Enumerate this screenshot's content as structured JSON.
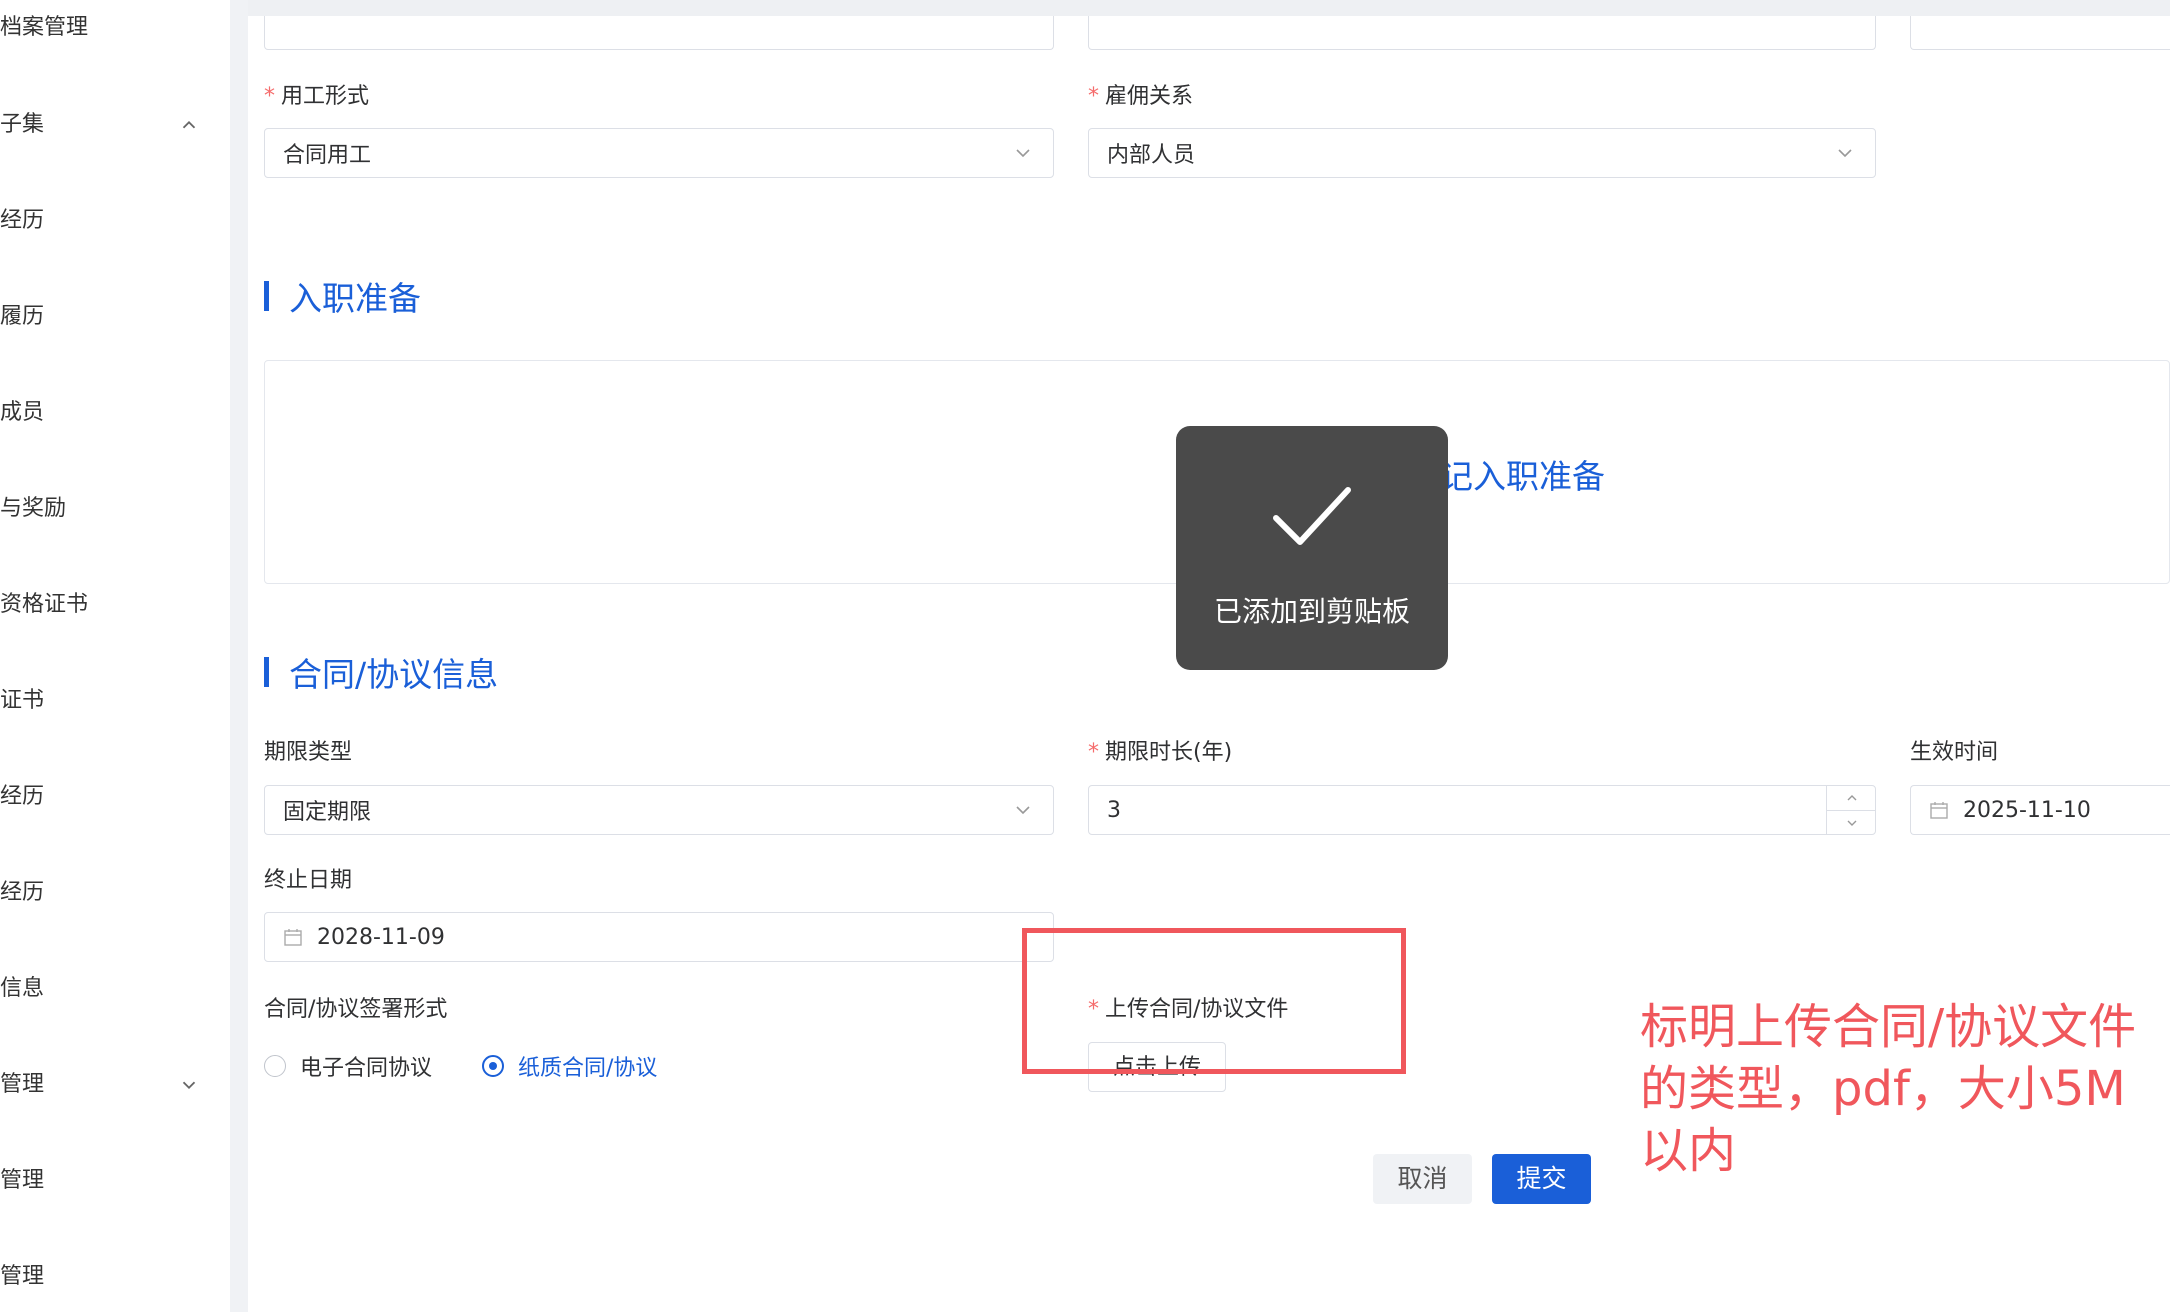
{
  "sidebar": {
    "items": [
      {
        "label": "档案管理"
      },
      {
        "label": "子集"
      },
      {
        "label": "经历"
      },
      {
        "label": "履历"
      },
      {
        "label": "成员"
      },
      {
        "label": "与奖励"
      },
      {
        "label": "资格证书"
      },
      {
        "label": "证书"
      },
      {
        "label": "经历"
      },
      {
        "label": "经历"
      },
      {
        "label": "信息"
      },
      {
        "label": "管理"
      },
      {
        "label": "管理"
      },
      {
        "label": "管理"
      }
    ]
  },
  "form": {
    "employment_form": {
      "label": "用工形式",
      "value": "合同用工"
    },
    "employment_relation": {
      "label": "雇佣关系",
      "value": "内部人员"
    },
    "prep_section_title": "入职准备",
    "prep_link": "记入职准备",
    "contract_section_title": "合同/协议信息",
    "term_type": {
      "label": "期限类型",
      "value": "固定期限"
    },
    "term_years": {
      "label": "期限时长(年)",
      "value": "3"
    },
    "effective_date": {
      "label": "生效时间",
      "value": "2025-11-10"
    },
    "end_date": {
      "label": "终止日期",
      "value": "2028-11-09"
    },
    "sign_form": {
      "label": "合同/协议签署形式",
      "options": [
        "电子合同协议",
        "纸质合同/协议"
      ],
      "selected": "纸质合同/协议"
    },
    "upload": {
      "label": "上传合同/协议文件",
      "button_label": "点击上传"
    },
    "cancel_label": "取消",
    "submit_label": "提交"
  },
  "toast": {
    "message": "已添加到剪贴板"
  },
  "annotation": {
    "text": "标明上传合同/协议文件的类型，pdf，大小5M以内"
  },
  "colors": {
    "accent": "#1a5fd8",
    "annotation": "#f0575c",
    "toast_bg": "#4a4a4a"
  }
}
